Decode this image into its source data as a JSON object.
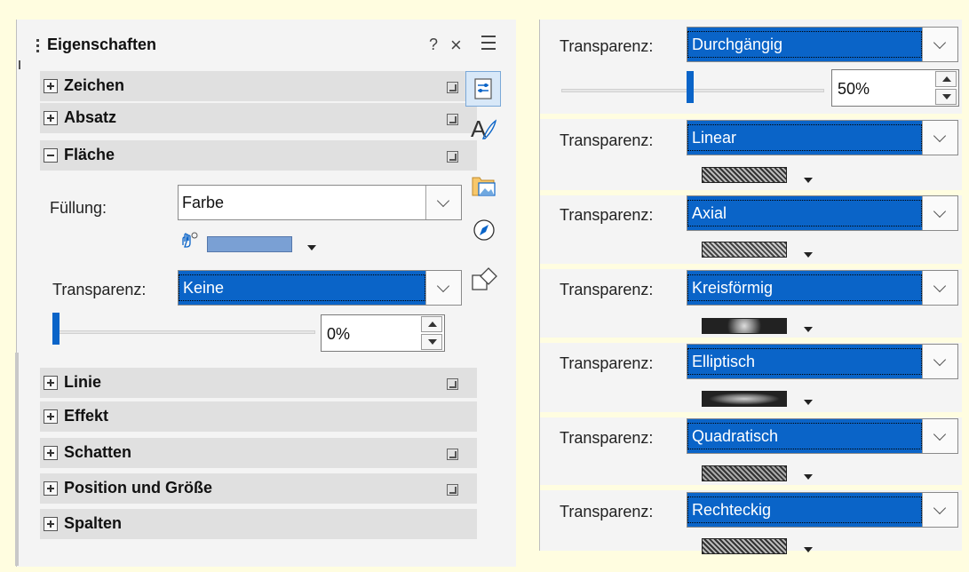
{
  "panel": {
    "title": "Eigenschaften",
    "help": "?",
    "close": "×",
    "sections": [
      {
        "label": "Zeichen",
        "state": "plus",
        "more": true
      },
      {
        "label": "Absatz",
        "state": "plus",
        "more": true
      },
      {
        "label": "Fläche",
        "state": "minus",
        "more": true
      },
      {
        "label": "Linie",
        "state": "plus",
        "more": true
      },
      {
        "label": "Effekt",
        "state": "plus",
        "more": false
      },
      {
        "label": "Schatten",
        "state": "plus",
        "more": true
      },
      {
        "label": "Position und Größe",
        "state": "plus",
        "more": true
      },
      {
        "label": "Spalten",
        "state": "plus",
        "more": false
      }
    ],
    "flaeche": {
      "fill_label": "Füllung:",
      "fill_value": "Farbe",
      "transparency_label": "Transparenz:",
      "transparency_value": "Keine",
      "spin_value": "0%",
      "slider_level": 0
    }
  },
  "right": {
    "label": "Transparenz:",
    "first": {
      "value": "Durchgängig",
      "spin_value": "50%",
      "slider_level": 0.5
    },
    "items": [
      {
        "value": "Linear",
        "gradient": "linear"
      },
      {
        "value": "Axial",
        "gradient": "axial"
      },
      {
        "value": "Kreisförmig",
        "gradient": "radial"
      },
      {
        "value": "Elliptisch",
        "gradient": "ellipsoid"
      },
      {
        "value": "Quadratisch",
        "gradient": "square"
      },
      {
        "value": "Rechteckig",
        "gradient": "rectangular"
      }
    ]
  },
  "colors": {
    "accent": "#0a64c8",
    "fill_color": "#7aa0d4",
    "background": "#fffde0"
  }
}
